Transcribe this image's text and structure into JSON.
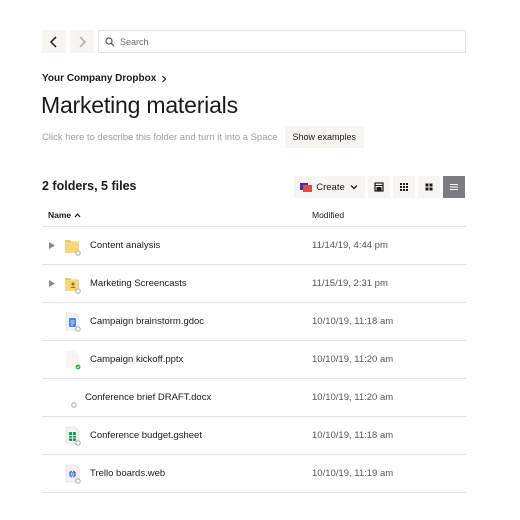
{
  "search": {
    "placeholder": "Search"
  },
  "breadcrumb": {
    "label": "Your Company Dropbox"
  },
  "page": {
    "title": "Marketing materials",
    "description": "Click here to describe this folder and turn it into a Space",
    "show_examples": "Show examples"
  },
  "summary": {
    "count": "2 folders, 5 files"
  },
  "toolbar": {
    "create_label": "Create"
  },
  "table": {
    "col_name": "Name",
    "col_modified": "Modified",
    "rows": [
      {
        "name": "Content analysis",
        "modified": "11/14/19, 4:44 pm",
        "type": "folder",
        "status": "gray"
      },
      {
        "name": "Marketing Screencasts",
        "modified": "11/15/19, 2:31 pm",
        "type": "folder-shared",
        "status": "gray"
      },
      {
        "name": "Campaign brainstorm.gdoc",
        "modified": "10/10/19, 11:18 am",
        "type": "gdoc",
        "status": "gray"
      },
      {
        "name": "Campaign kickoff.pptx",
        "modified": "10/10/19, 11:20 am",
        "type": "pptx",
        "status": "green"
      },
      {
        "name": "Conference brief DRAFT.docx",
        "modified": "10/10/19, 11:20 am",
        "type": "docx",
        "status": "gray"
      },
      {
        "name": "Conference budget.gsheet",
        "modified": "10/10/19, 11:18 am",
        "type": "gsheet",
        "status": "gray"
      },
      {
        "name": "Trello boards.web",
        "modified": "10/10/19, 11:19 am",
        "type": "web",
        "status": "gray"
      }
    ]
  },
  "colors": {
    "folder": "#f7c65a",
    "status_green": "#2eaa4a",
    "active_view": "#7d7c85",
    "gdoc": "#4285f4",
    "gsheet": "#0f9d58",
    "web": "#3b63d6"
  }
}
